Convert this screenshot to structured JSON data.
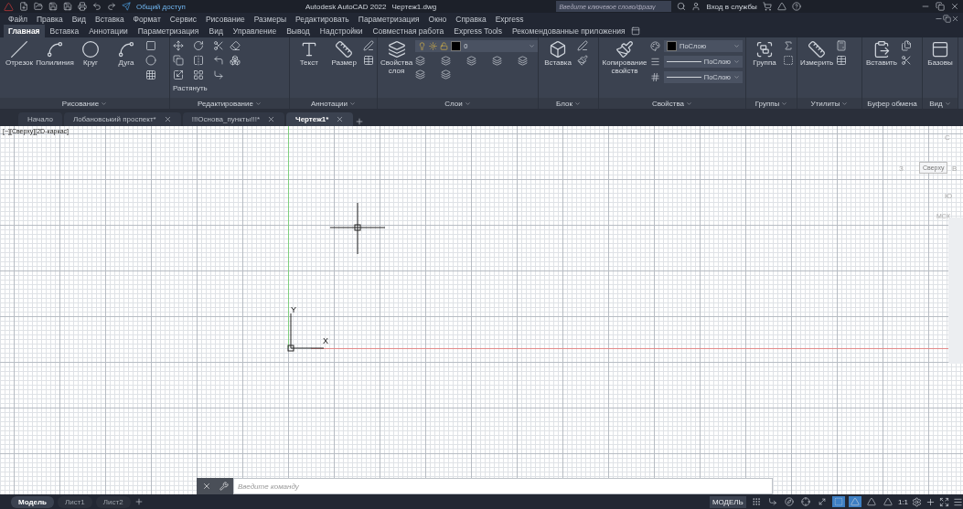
{
  "title_bar": {
    "share": "Общий доступ",
    "title": "Autodesk AutoCAD 2022",
    "file": "Чертеж1.dwg",
    "search": {
      "placeholder": "Введите ключевое слово/фразу"
    },
    "sign_in": "Вход в службы"
  },
  "menu": [
    "Файл",
    "Правка",
    "Вид",
    "Вставка",
    "Формат",
    "Сервис",
    "Рисование",
    "Размеры",
    "Редактировать",
    "Параметризация",
    "Окно",
    "Справка",
    "Express"
  ],
  "ribbon_tabs": [
    {
      "label": "Главная",
      "selected": true
    },
    {
      "label": "Вставка",
      "selected": false
    },
    {
      "label": "Аннотации",
      "selected": false
    },
    {
      "label": "Параметризация",
      "selected": false
    },
    {
      "label": "Вид",
      "selected": false
    },
    {
      "label": "Управление",
      "selected": false
    },
    {
      "label": "Вывод",
      "selected": false
    },
    {
      "label": "Надстройки",
      "selected": false
    },
    {
      "label": "Совместная работа",
      "selected": false
    },
    {
      "label": "Express Tools",
      "selected": false
    },
    {
      "label": "Рекомендованные приложения",
      "selected": false
    }
  ],
  "ribbon_panels": [
    {
      "title": "Рисование",
      "has_menu": true,
      "buttons": [
        "Отрезок",
        "Полилиния",
        "Круг",
        "Дуга"
      ]
    },
    {
      "title": "Редактирование",
      "has_menu": true,
      "text_buttons": [
        "Растянуть"
      ]
    },
    {
      "title": "Аннотации",
      "has_menu": true,
      "buttons": [
        "Текст",
        "Размер"
      ]
    },
    {
      "title": "Слои",
      "has_menu": true,
      "buttons": [
        "Свойства слоя"
      ],
      "dropdowns": [
        {
          "kind": "layer",
          "value": "0"
        }
      ]
    },
    {
      "title": "Блок",
      "has_menu": true,
      "buttons": [
        "Вставка"
      ]
    },
    {
      "title": "Свойства",
      "has_menu": true,
      "buttons": [
        "Копирование свойств"
      ],
      "dropdowns": [
        {
          "kind": "color",
          "value": "ПоСлою"
        },
        {
          "kind": "line",
          "value": "ПоСлою"
        },
        {
          "kind": "line",
          "value": "ПоСлою"
        }
      ]
    },
    {
      "title": "Группы",
      "has_menu": true,
      "buttons": [
        "Группа"
      ]
    },
    {
      "title": "Утилиты",
      "has_menu": true,
      "buttons": [
        "Измерить"
      ]
    },
    {
      "title": "Буфер обмена",
      "has_menu": false,
      "buttons": [
        "Вставить"
      ]
    },
    {
      "title": "Вид",
      "has_menu": true,
      "buttons": [
        "Базовы"
      ]
    }
  ],
  "doc_tabs": [
    {
      "label": "Начало",
      "selected": false,
      "closable": false
    },
    {
      "label": "Лобановський проспект*",
      "selected": false,
      "closable": true
    },
    {
      "label": "!!!Основа_пункты!!!*",
      "selected": false,
      "closable": true
    },
    {
      "label": "Чертеж1*",
      "selected": true,
      "closable": true
    }
  ],
  "viewport": {
    "label": "[−][Сверху][2D-каркас]",
    "ucs": {
      "y": "Y",
      "x": "X"
    },
    "viewcube": {
      "north": "С",
      "west": "З",
      "face": "Сверху",
      "east": "В",
      "south": "Ю",
      "ucs": "МСК"
    }
  },
  "command_line": {
    "placeholder": "Введите команду"
  },
  "layout_tabs": [
    {
      "label": "Модель",
      "selected": true
    },
    {
      "label": "Лист1",
      "selected": false
    },
    {
      "label": "Лист2",
      "selected": false
    }
  ],
  "status_bar": {
    "space": "МОДЕЛЬ",
    "scale": "1:1",
    "toggles": [
      {
        "on": false
      },
      {
        "on": false
      },
      {
        "on": false
      },
      {
        "on": false
      },
      {
        "on": false
      },
      {
        "on": true
      },
      {
        "on": true
      },
      {
        "on": false
      },
      {
        "on": false
      }
    ]
  }
}
